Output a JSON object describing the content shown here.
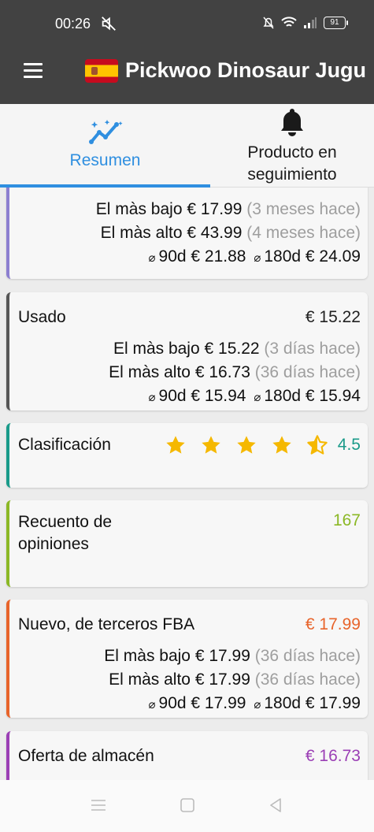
{
  "status_bar": {
    "time": "00:26",
    "battery": "91"
  },
  "app_bar": {
    "title": "Pickwoo Dinosaur Jugu"
  },
  "tabs": {
    "summary": "Resumen",
    "tracked": "Producto en seguimiento"
  },
  "cards": {
    "new_partial": {
      "color": "#8c7fd0",
      "lowest": {
        "label": "El màs bajo",
        "price": "€ 17.99",
        "ago": "(3 meses hace)"
      },
      "highest": {
        "label": "El màs alto",
        "price": "€ 43.99",
        "ago": "(4 meses hace)"
      },
      "avg": {
        "d90_label": "90d",
        "d90": "€ 21.88",
        "d180_label": "180d",
        "d180": "€ 24.09"
      }
    },
    "used": {
      "title": "Usado",
      "value": "€ 15.22",
      "color": "#555555",
      "lowest": {
        "label": "El màs bajo",
        "price": "€ 15.22",
        "ago": "(3 días hace)"
      },
      "highest": {
        "label": "El màs alto",
        "price": "€ 16.73",
        "ago": "(36 días hace)"
      },
      "avg": {
        "d90_label": "90d",
        "d90": "€ 15.94",
        "d180_label": "180d",
        "d180": "€ 15.94"
      }
    },
    "rating": {
      "title": "Clasificación",
      "value": "4.5",
      "stars": 4.5,
      "color": "#1a9b8a"
    },
    "reviews": {
      "title": "Recuento de opiniones",
      "value": "167",
      "color": "#8bb825"
    },
    "fba": {
      "title": "Nuevo, de terceros FBA",
      "value": "€ 17.99",
      "color": "#e8642b",
      "lowest": {
        "label": "El màs bajo",
        "price": "€ 17.99",
        "ago": "(36 días hace)"
      },
      "highest": {
        "label": "El màs alto",
        "price": "€ 17.99",
        "ago": "(36 días hace)"
      },
      "avg": {
        "d90_label": "90d",
        "d90": "€ 17.99",
        "d180_label": "180d",
        "d180": "€ 17.99"
      }
    },
    "warehouse": {
      "title": "Oferta de almacén",
      "value": "€ 16.73",
      "color": "#9b3fb5"
    }
  }
}
